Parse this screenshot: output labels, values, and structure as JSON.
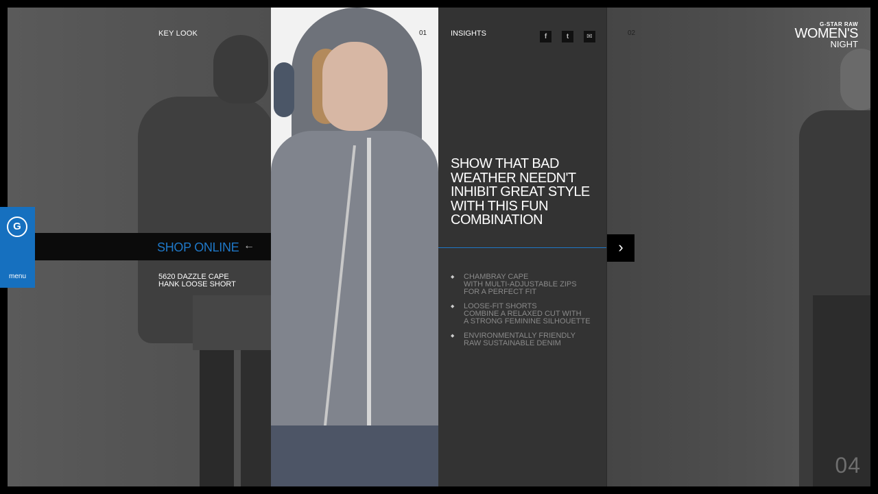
{
  "left_panel": {
    "section_label": "KEY LOOK",
    "section_number": "01",
    "shop_online": "SHOP ONLINE",
    "shop_arrow": "←",
    "products": [
      "5620 DAZZLE CAPE",
      "HANK LOOSE SHORT"
    ]
  },
  "insights": {
    "title": "INSIGHTS",
    "social": {
      "facebook": "f",
      "twitter": "t",
      "email": "✉"
    },
    "headline": "SHOW THAT BAD WEATHER NEEDN'T INHIBIT GREAT STYLE WITH THIS FUN COMBINATION",
    "features": [
      "CHAMBRAY CAPE\nWITH MULTI-ADJUSTABLE ZIPS\nFOR A PERFECT FIT",
      "LOOSE-FIT SHORTS\nCOMBINE A RELAXED CUT WITH\nA STRONG FEMININE SILHOUETTE",
      "ENVIRONMENTALLY FRIENDLY\nRAW SUSTAINABLE DENIM"
    ]
  },
  "right_panel": {
    "section_number": "02"
  },
  "navigation": {
    "next_icon": "›"
  },
  "brand": {
    "small": "G-STAR RAW",
    "big": "WOMEN'S",
    "night": "NIGHT"
  },
  "page_number": "04",
  "menu": {
    "label": "menu",
    "logo": "G"
  },
  "colors": {
    "accent_blue": "#1f79c9",
    "menu_blue": "#1670bf"
  }
}
